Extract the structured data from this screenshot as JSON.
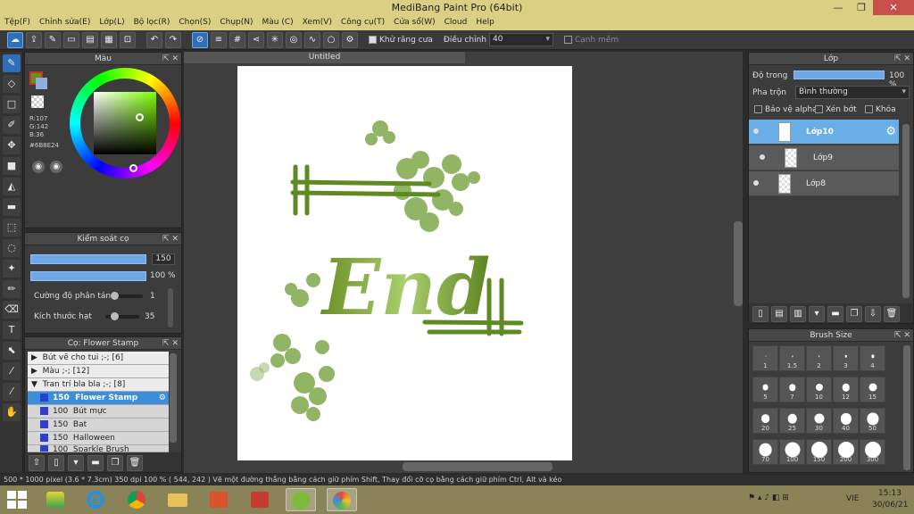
{
  "window": {
    "title": "MediBang Paint Pro (64bit)",
    "minimize": "—",
    "maximize": "❐",
    "close": "✕"
  },
  "menu": [
    "Tệp(F)",
    "Chỉnh sửa(E)",
    "Lớp(L)",
    "Bộ lọc(R)",
    "Chọn(S)",
    "Chụp(N)",
    "Màu (C)",
    "Xem(V)",
    "Công cụ(T)",
    "Cửa sổ(W)",
    "Cloud",
    "Help"
  ],
  "toolbar": {
    "antialias_label": "Khử răng cưa",
    "correction_label": "Điều chỉnh",
    "correction_value": "40",
    "soft_edge_label": "Cạnh mềm"
  },
  "color_panel": {
    "title": "Màu",
    "r": "R:107",
    "g": "G:142",
    "b": "B:36",
    "hex": "#6B8E24",
    "primary": "#6b8e24",
    "secondary": "#8fb0de"
  },
  "brush_control": {
    "title": "Kiểm soát cọ",
    "size": "150",
    "opacity": "100 %",
    "scatter_label": "Cường độ phân tán",
    "scatter_value": "1",
    "grain_label": "Kích thước hạt",
    "grain_value": "35"
  },
  "brush_list": {
    "title": "Cọ: Flower Stamp",
    "groups": [
      {
        "label": "Bút vẽ cho tui ;-; [6]"
      },
      {
        "label": "Màu ;-; [12]"
      },
      {
        "label": "Tran trí bla bla ;-; [8]"
      }
    ],
    "items": [
      {
        "size": "150",
        "name": "Flower Stamp"
      },
      {
        "size": "100",
        "name": "Bút mực"
      },
      {
        "size": "150",
        "name": "Bat"
      },
      {
        "size": "150",
        "name": "Halloween"
      },
      {
        "size": "100",
        "name": "Sparkle Brush"
      }
    ]
  },
  "document": {
    "tab": "Untitled",
    "art_text": "End"
  },
  "layer_panel": {
    "title": "Lớp",
    "opacity_label": "Độ trong",
    "opacity_value": "100 %",
    "opacity_level": 1.0,
    "blend_label": "Pha trộn",
    "blend_value": "Bình thường",
    "protect_alpha": "Bảo vệ alpha",
    "clipping": "Xén bớt",
    "lock": "Khóa",
    "layers": [
      "Lớp10",
      "Lớp9",
      "Lớp8"
    ]
  },
  "brush_size": {
    "title": "Brush Size",
    "sizes": [
      "1",
      "1.5",
      "2",
      "3",
      "4",
      "5",
      "7",
      "10",
      "12",
      "15",
      "20",
      "25",
      "30",
      "40",
      "50",
      "70",
      "100",
      "150",
      "200",
      "300"
    ]
  },
  "status": {
    "text": "500 * 1000 pixel    (3.6 * 7.3cm)    350 dpi    100 %    ( 544, 242 )    Vẽ một đường thẳng bằng cách giữ phím Shift, Thay đổi cỡ cọ bằng cách giữ phím Ctrl, Alt và kéo"
  },
  "taskbar": {
    "lang": "VIE",
    "time": "15:13",
    "date": "30/06/21"
  }
}
